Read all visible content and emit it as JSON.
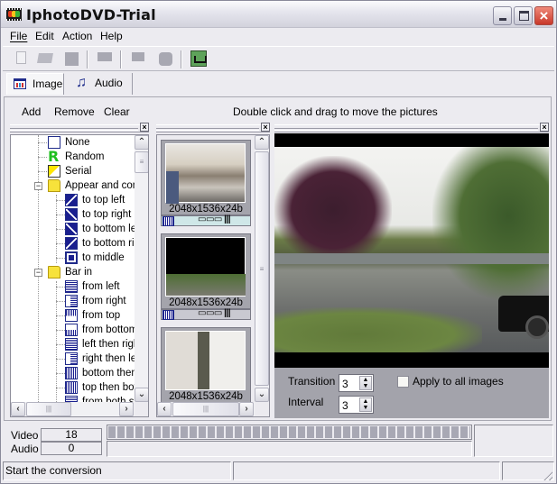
{
  "window": {
    "title": "IphotoDVD-Trial",
    "controls": {
      "minimize": "minimize",
      "maximize": "maximize",
      "close": "×"
    }
  },
  "menubar": {
    "items": [
      {
        "label": "File",
        "mnemonic": "F"
      },
      {
        "label": "Edit",
        "mnemonic": "E"
      },
      {
        "label": "Action",
        "mnemonic": "A"
      },
      {
        "label": "Help",
        "mnemonic": "H"
      }
    ]
  },
  "toolbar": {
    "buttons": [
      {
        "icon": "new-file-icon",
        "enabled": false
      },
      {
        "icon": "open-folder-icon",
        "enabled": false
      },
      {
        "icon": "save-icon",
        "enabled": false
      },
      {
        "icon": "monitor-icon",
        "enabled": false
      },
      {
        "icon": "screen-icon",
        "enabled": false
      },
      {
        "icon": "disc-icon",
        "enabled": false
      },
      {
        "icon": "shopping-cart-icon",
        "enabled": true
      }
    ]
  },
  "tabs": [
    {
      "label": "Image",
      "icon": "image-grid-icon",
      "active": true
    },
    {
      "label": "Audio",
      "icon": "music-note-icon",
      "active": false
    }
  ],
  "actions": {
    "add": "Add",
    "remove": "Remove",
    "clear": "Clear",
    "hint": "Double click and drag to move the pictures"
  },
  "effects_tree": {
    "items": [
      {
        "label": "None",
        "icon": "none",
        "level": 0
      },
      {
        "label": "Random",
        "icon": "random",
        "level": 0
      },
      {
        "label": "Serial",
        "icon": "serial",
        "level": 0
      },
      {
        "label": "Appear and con",
        "icon": "folder",
        "level": 0,
        "expanded": true
      },
      {
        "label": "to top left",
        "icon": "trans",
        "level": 1
      },
      {
        "label": "to top right",
        "icon": "trans2",
        "level": 1
      },
      {
        "label": "to bottom lef",
        "icon": "trans2",
        "level": 1
      },
      {
        "label": "to bottom rig",
        "icon": "trans",
        "level": 1
      },
      {
        "label": "to middle",
        "icon": "mid",
        "level": 1
      },
      {
        "label": "Bar in",
        "icon": "folder",
        "level": 0,
        "expanded": true
      },
      {
        "label": "from left",
        "icon": "bar",
        "level": 1
      },
      {
        "label": "from right",
        "icon": "bar-half",
        "level": 1
      },
      {
        "label": "from top",
        "icon": "barv-top",
        "level": 1
      },
      {
        "label": "from bottom",
        "icon": "barv-bot",
        "level": 1
      },
      {
        "label": "left then righ",
        "icon": "bar",
        "level": 1
      },
      {
        "label": "right then lel",
        "icon": "bar-half",
        "level": 1
      },
      {
        "label": "bottom then",
        "icon": "barv",
        "level": 1
      },
      {
        "label": "top then bot",
        "icon": "barv",
        "level": 1
      },
      {
        "label": "from both sic",
        "icon": "bar",
        "level": 1
      }
    ]
  },
  "thumbnails": [
    {
      "label": "2048x1536x24b",
      "image": "kitchen-interior",
      "bar_glyph": "▭▭▭ |||",
      "selected": true
    },
    {
      "label": "2048x1536x24b",
      "image": "roadside-trees",
      "bar_glyph": "▭▭▭ |||",
      "selected": false
    },
    {
      "label": "2048x1536x24b",
      "image": "kitchen-cabinets",
      "bar_glyph": "",
      "selected": false
    }
  ],
  "preview": {
    "image": "roadside-trees-truck"
  },
  "settings": {
    "transition_label": "Transition",
    "transition_value": "3",
    "interval_label": "Interval",
    "interval_value": "3",
    "apply_all_label": "Apply to all images",
    "apply_all_checked": false
  },
  "counters": {
    "video_label": "Video",
    "video_value": "18",
    "audio_label": "Audio",
    "audio_value": "0"
  },
  "progress": {
    "fraction": 1.0
  },
  "statusbar": {
    "message": "Start the conversion",
    "cell2": "",
    "cell3": ""
  }
}
